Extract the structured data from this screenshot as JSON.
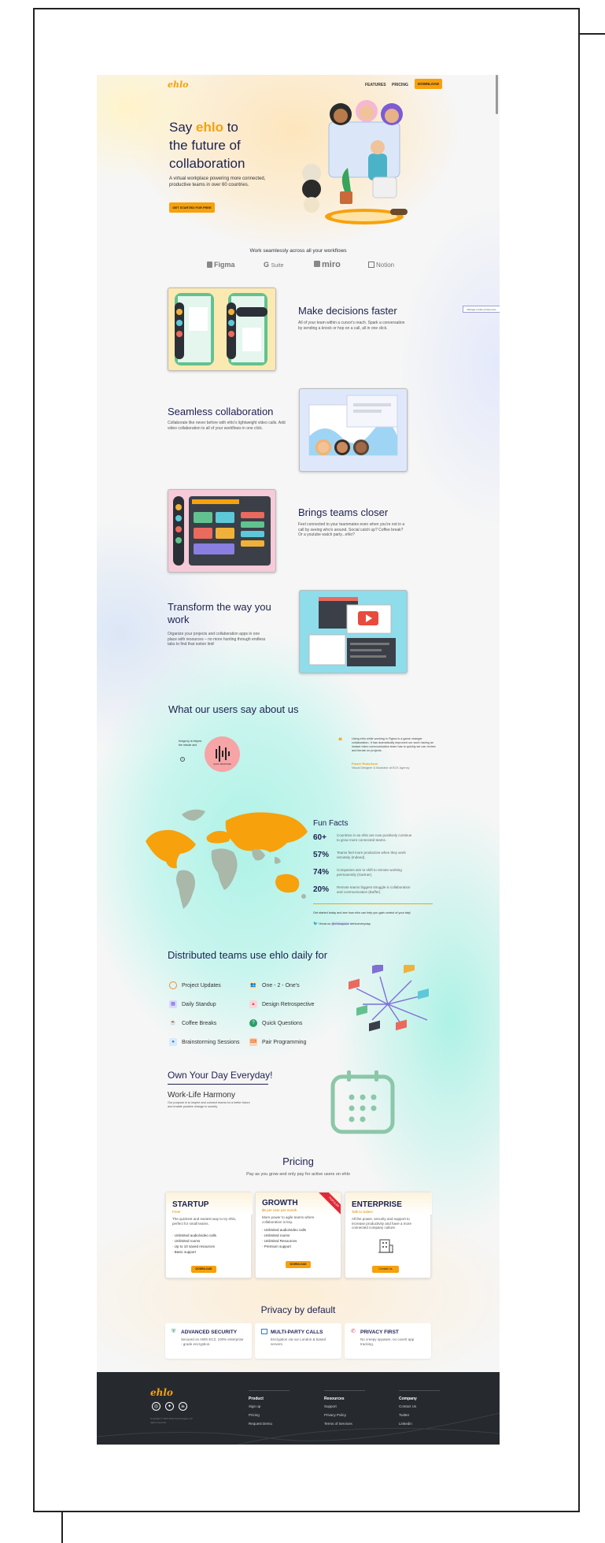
{
  "brand": "ehlo",
  "nav": {
    "features": "FEATURES",
    "pricing": "PRICING",
    "download": "DOWNLOAD"
  },
  "hero": {
    "title_pre": "Say ",
    "title_brand": "ehlo",
    "title_post": " to",
    "title_line2": "the future of",
    "title_line3": "collaboration",
    "subtitle": "A virtual workplace powering more connected, productive teams in over 60 countries.",
    "cta": "GET STARTED FOR FREE"
  },
  "workflows": {
    "heading": "Work seamlessly across all your workflows",
    "logos": [
      "Figma",
      "Suite",
      "miro",
      "Notion"
    ]
  },
  "side_tab": "Manage cookie preferences",
  "features": [
    {
      "title": "Make decisions faster",
      "text": "All of your team within a cursor's reach. Spark a conversation by sending a knock or hop on a call, all in one click."
    },
    {
      "title": "Seamless collaboration",
      "text": "Collaborate like never before with ehlo's lightweight video calls. Add video collaboration to all of your workflows in one click."
    },
    {
      "title": "Brings teams closer",
      "text": "Feel connected to your teammates even when you're not in a call by seeing who's around. Social catch up? Coffee break? Or a youtube watch party...ehlo?"
    },
    {
      "title": "Transform the way you work",
      "text": "Organize your projects and collaboration apps in one place with resources – no more hunting through endless tabs to find that notion link!"
    }
  ],
  "testimonials": {
    "heading": "What our users say about us",
    "left_snippet": "things by is helped the minute and",
    "center_caption": "QUICK RESPONSE",
    "quote": "Using ehlo while working in Figma is a game changer collaboration. It has dramatically improved our work having an instant video communication team has to quickly we can review and iterate on projects.",
    "author": "Fraser Robertson",
    "role": "Visual Designer & Illustrator at BCK Agency"
  },
  "fun_facts": {
    "heading": "Fun Facts",
    "items": [
      {
        "num": "60+",
        "text": "Countries in an ehlo are now positively continue to grow more connected teams."
      },
      {
        "num": "57%",
        "text": "Teams feel more productive when they work remotely (Indeed)."
      },
      {
        "num": "74%",
        "text": "Companies aim to shift to remote working permanently (Gartner)."
      },
      {
        "num": "20%",
        "text": "Remote teams biggest struggle is collaboration and communication (Buffer)."
      }
    ],
    "cta_line": "Get started today and see how ehlo can help you gain control of your day!",
    "twitter_pre": "Head us",
    "twitter_handle": "@ehlospace",
    "twitter_tag": "#ehloeveryday"
  },
  "use_cases": {
    "heading": "Distributed teams use ehlo daily for",
    "left": [
      "Project Updates",
      "Daily Standup",
      "Coffee Breaks",
      "Brainstorming Sessions"
    ],
    "right": [
      "One - 2 - One's",
      "Design Retrospective",
      "Quick Questions",
      "Pair Programming"
    ]
  },
  "own_day": {
    "heading": "Own Your Day Everyday!",
    "sub": "Work-Life Harmony",
    "text": "Our purpose is to inspire and connect teams for a better future and enable positive change in society."
  },
  "pricing": {
    "heading": "Pricing",
    "sub": "Pay as you grow and only pay for active users on ehlo",
    "plans": [
      {
        "name": "STARTUP",
        "price": "Free!",
        "desc": "The quickest and easiest way to try ehlo, perfect for small teams.",
        "features": [
          "Unlimited audio/video calls",
          "Unlimited rooms",
          "Up to 10 saved resources",
          "Basic support"
        ],
        "cta": "DOWNLOAD"
      },
      {
        "name": "GROWTH",
        "price": "$6 per user per month",
        "desc": "More power to agile teams where collaboration is key.",
        "features": [
          "Unlimited audio/video calls",
          "Unlimited rooms",
          "Unlimited Resources",
          "Premium support"
        ],
        "cta": "DOWNLOAD",
        "ribbon": "POPULAR"
      },
      {
        "name": "ENTERPRISE",
        "price": "Talk to Sales!",
        "desc": "All the power, security and support to increase productivity and have a more connected company culture.",
        "features": [],
        "cta": "Contact Us"
      }
    ]
  },
  "privacy": {
    "heading": "Privacy by default",
    "cards": [
      {
        "icon": "shield-icon",
        "title": "ADVANCED SECURITY",
        "text": "Secured on AWS EC2, 100% enterprise - grade encryption."
      },
      {
        "icon": "video-icon",
        "title": "MULTI-PARTY CALLS",
        "text": "Encryption via our London & based servers."
      },
      {
        "icon": "phone-icon",
        "title": "PRIVACY FIRST",
        "text": "No creepy spyware, no covert app tracking."
      }
    ]
  },
  "footer": {
    "copyright": "Copyright © 2021 Ehlo Technologies. All rights reserved.",
    "columns": [
      {
        "head": "Product",
        "links": [
          "Sign up",
          "Pricing",
          "Request Demo"
        ]
      },
      {
        "head": "Resources",
        "links": [
          "Support",
          "Privacy Policy",
          "Terms of Services"
        ]
      },
      {
        "head": "Company",
        "links": [
          "Contact Us",
          "Twitter",
          "Linkedin"
        ]
      }
    ]
  },
  "colors": {
    "accent": "#f7a10c",
    "navy": "#1d2150",
    "mint": "#a9efe3",
    "footer": "#262a2e"
  }
}
